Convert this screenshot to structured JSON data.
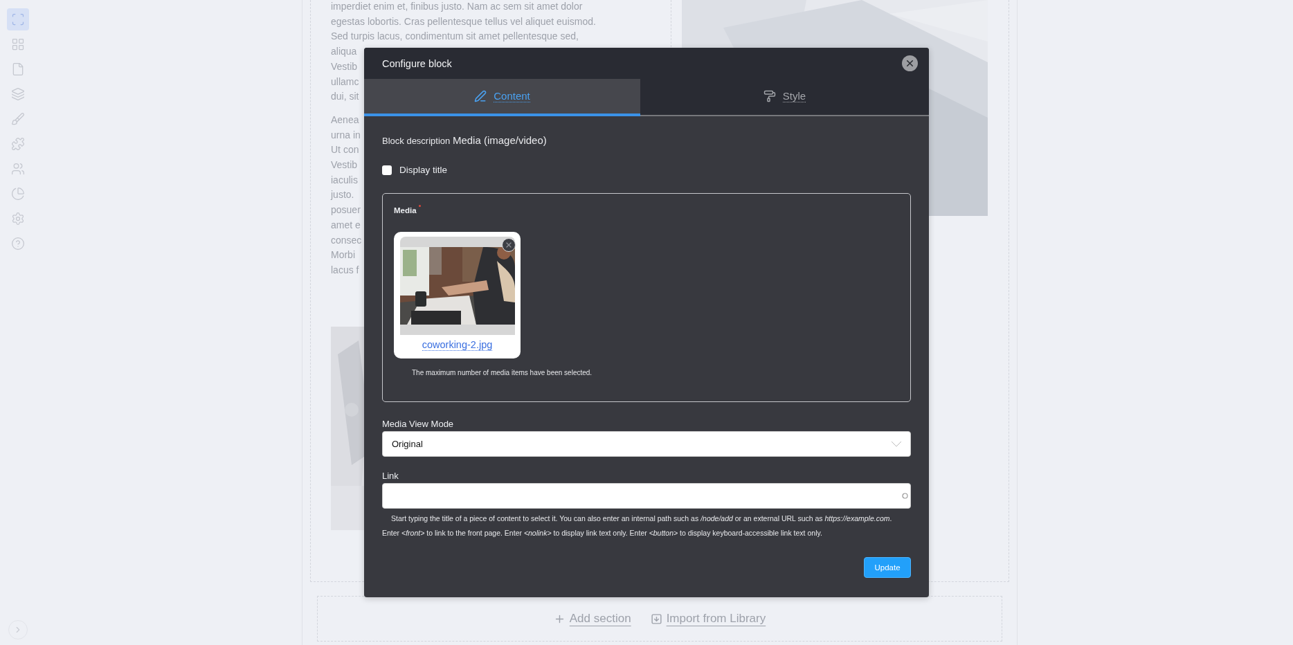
{
  "sidebar": {
    "items": [
      {
        "selected": true
      },
      {
        "selected": false
      },
      {
        "selected": false
      },
      {
        "selected": false
      },
      {
        "selected": false
      },
      {
        "selected": false
      },
      {
        "selected": false
      },
      {
        "selected": false
      },
      {
        "selected": false
      },
      {
        "selected": false
      }
    ]
  },
  "page": {
    "paragraphs": [
      [
        "imperdiet enim et, finibus justo. Nam ac sem sit amet dolor",
        "egestas lobortis. Cras pellentesque tellus vel aliquet euismod.",
        "Sed turpis lacus, condimentum sit amet pellentesque sed,",
        "aliqua",
        "Vestib",
        "ullamc",
        "dui, sit"
      ],
      [
        "Aenea",
        "urna in",
        "Ut con",
        "Vestib",
        "iaculis",
        "justo.",
        "posuer",
        "amet e",
        "consec",
        "Morbi",
        "lacus f"
      ]
    ],
    "actions": [
      {
        "label": "Add section",
        "kind": "add"
      },
      {
        "label": "Import from Library",
        "kind": "import"
      }
    ]
  },
  "modal": {
    "title": "Configure block",
    "tabs": [
      {
        "label": "Content",
        "selected": true,
        "kind": "content"
      },
      {
        "label": "Style",
        "selected": false,
        "kind": "style"
      }
    ],
    "block_description": {
      "label": "Block description",
      "value": "Media (image/video)"
    },
    "display_title": {
      "label": "Display title",
      "checked": false
    },
    "media": {
      "label": "Media",
      "required": true,
      "items": [
        {
          "filename": "coworking-2.jpg"
        }
      ],
      "note": "The maximum number of media items have been selected."
    },
    "view_mode": {
      "label": "Media View Mode",
      "value": "Original"
    },
    "link": {
      "label": "Link",
      "help": "Start typing the title of a piece of content to select it. You can also enter an internal path such as */node/add* or an external URL such as *https://example.com*. Enter *<front>* to link to the front page. Enter *<nolink>* to display link text only. Enter *<button>* to display keyboard-accessible link text only."
    },
    "submit": "Update"
  }
}
